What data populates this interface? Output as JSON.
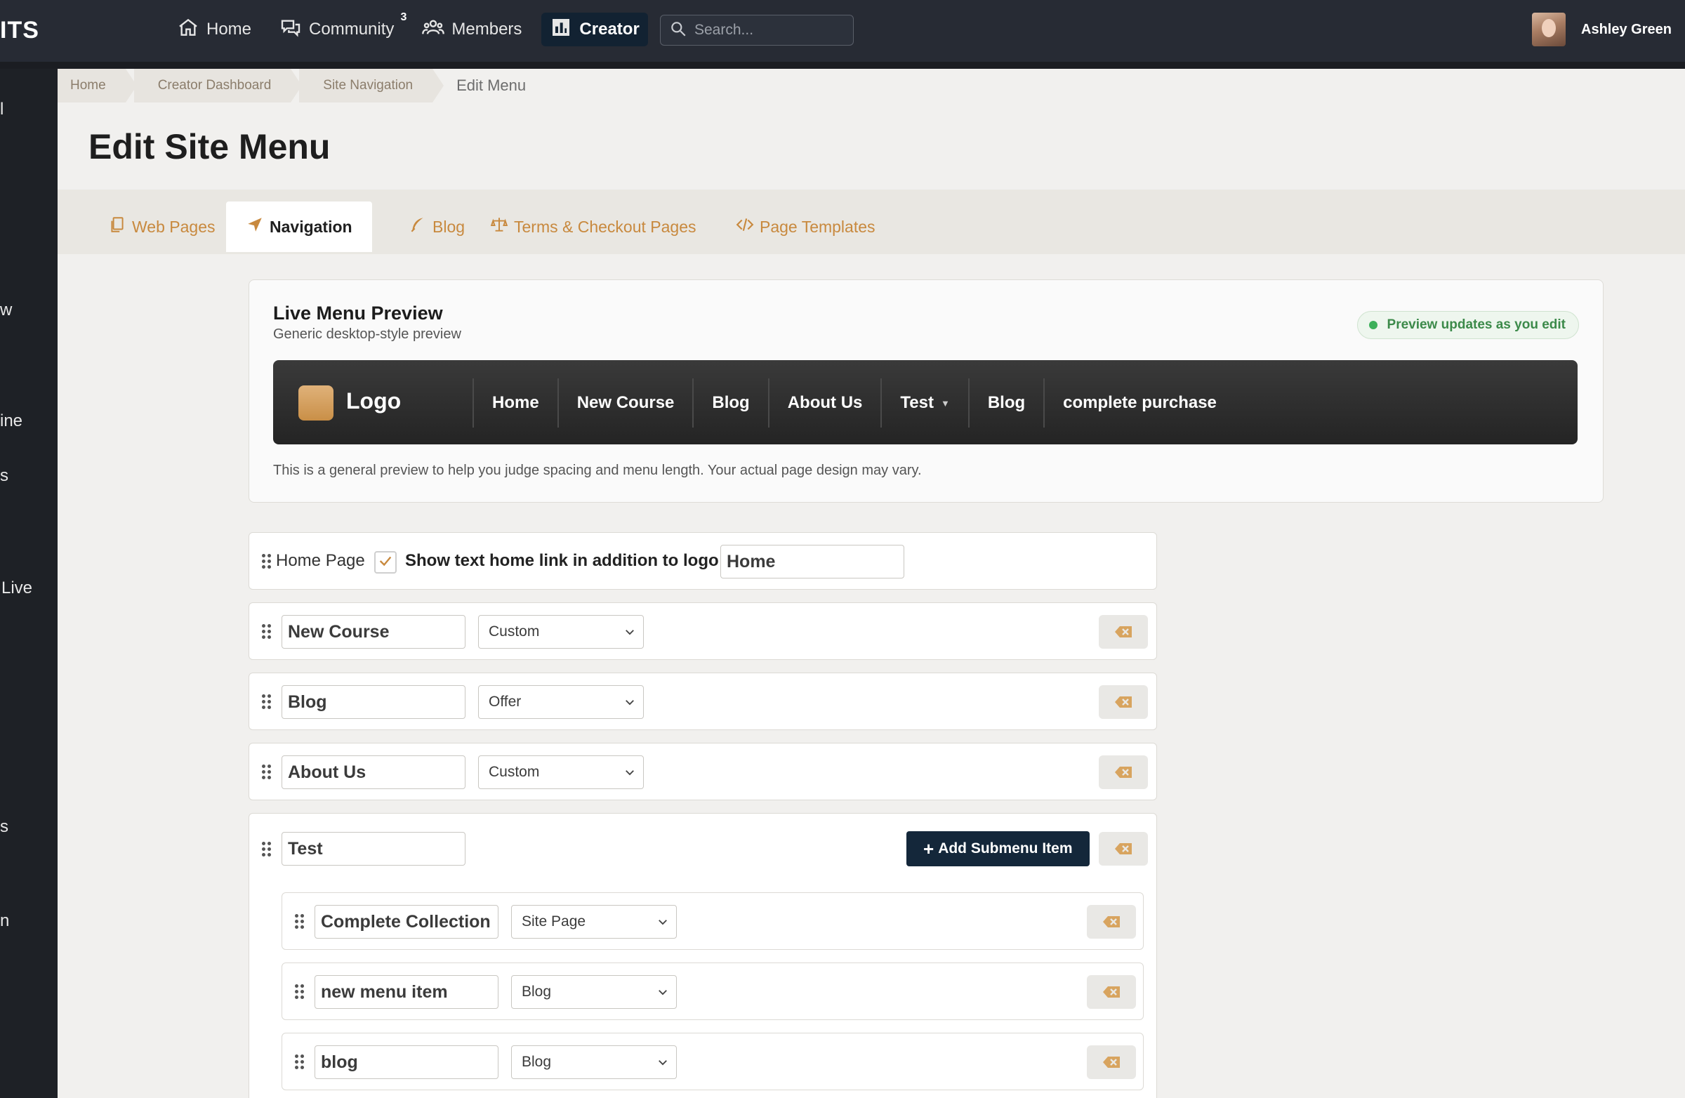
{
  "topbar": {
    "brand": "ITS",
    "nav": [
      {
        "label": "Home",
        "icon": "home-icon"
      },
      {
        "label": "Community",
        "icon": "chat-icon",
        "badge": "3"
      },
      {
        "label": "Members",
        "icon": "members-icon"
      },
      {
        "label": "Creator",
        "icon": "chart-icon",
        "active": true
      }
    ],
    "search_placeholder": "Search...",
    "user_name": "Ashley Green"
  },
  "sidebar": {
    "fragments": [
      "l",
      "w",
      "ine",
      "s",
      "Live",
      "s",
      "n"
    ]
  },
  "breadcrumb": [
    "Home",
    "Creator Dashboard",
    "Site Navigation",
    "Edit Menu"
  ],
  "page_title": "Edit Site Menu",
  "tabs": [
    {
      "label": "Web Pages",
      "icon": "pages-icon"
    },
    {
      "label": "Navigation",
      "icon": "navigation-icon",
      "active": true
    },
    {
      "label": "Blog",
      "icon": "pen-icon"
    },
    {
      "label": "Terms & Checkout Pages",
      "icon": "scale-icon"
    },
    {
      "label": "Page Templates",
      "icon": "code-icon"
    }
  ],
  "preview": {
    "title": "Live Menu Preview",
    "subtitle": "Generic desktop-style preview",
    "status": "Preview updates as you edit",
    "logo_text": "Logo",
    "items": [
      "Home",
      "New Course",
      "Blog",
      "About Us",
      "Test",
      "Blog",
      "complete purchase"
    ],
    "note": "This is a general preview to help you judge spacing and menu length. Your actual page design may vary."
  },
  "home_row": {
    "label": "Home Page",
    "checkbox_label": "Show text home link in addition to logo",
    "checked": true,
    "home_text": "Home"
  },
  "menu_rows": [
    {
      "name": "New Course",
      "type": "Custom"
    },
    {
      "name": "Blog",
      "type": "Offer"
    },
    {
      "name": "About Us",
      "type": "Custom"
    }
  ],
  "test_row": {
    "name": "Test",
    "add_submenu_label": "Add Submenu Item",
    "submenu": [
      {
        "name": "Complete Collection",
        "type": "Site Page"
      },
      {
        "name": "new menu item",
        "type": "Blog"
      },
      {
        "name": "blog",
        "type": "Blog"
      }
    ]
  },
  "colors": {
    "accent": "#c8893e",
    "topbar": "#272b34",
    "primary_button": "#14273a",
    "status_green": "#3cb05a"
  }
}
